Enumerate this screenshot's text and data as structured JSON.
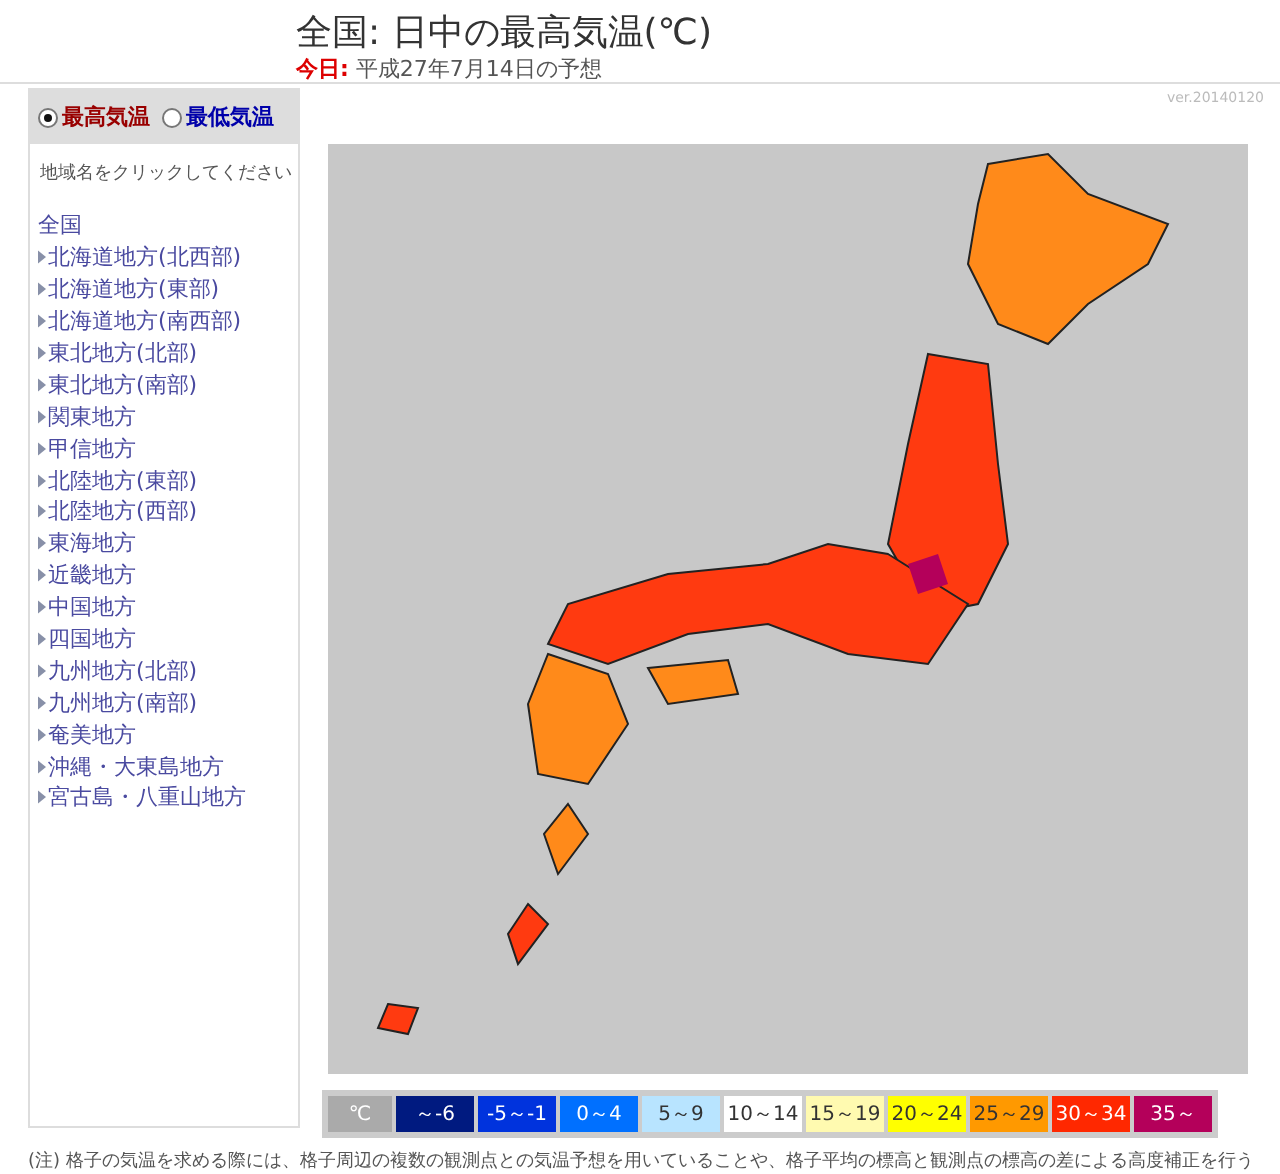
{
  "header": {
    "title": "全国: 日中の最高気温(℃)",
    "date_label": "今日:",
    "date_text": "平成27年7月14日の予想"
  },
  "version": "ver.20140120",
  "sidebar": {
    "radios": [
      {
        "label": "最高気温",
        "selected": true
      },
      {
        "label": "最低気温",
        "selected": false
      }
    ],
    "instruction": "地域名をクリックしてください",
    "items": [
      {
        "label": "全国",
        "kind": "all"
      },
      {
        "label": "北海道地方(北西部)",
        "kind": "region"
      },
      {
        "label": "北海道地方(東部)",
        "kind": "region"
      },
      {
        "label": "北海道地方(南西部)",
        "kind": "region"
      },
      {
        "label": "東北地方(北部)",
        "kind": "region"
      },
      {
        "label": "東北地方(南部)",
        "kind": "region"
      },
      {
        "label": "関東地方",
        "kind": "region"
      },
      {
        "label": "甲信地方",
        "kind": "region"
      },
      {
        "label": "北陸地方(東部)",
        "kind": "region"
      },
      {
        "label": "北陸地方(西部)",
        "kind": "region"
      },
      {
        "label": "東海地方",
        "kind": "region"
      },
      {
        "label": "近畿地方",
        "kind": "region"
      },
      {
        "label": "中国地方",
        "kind": "region"
      },
      {
        "label": "四国地方",
        "kind": "region"
      },
      {
        "label": "九州地方(北部)",
        "kind": "region"
      },
      {
        "label": "九州地方(南部)",
        "kind": "region"
      },
      {
        "label": "奄美地方",
        "kind": "region"
      },
      {
        "label": "沖縄・大東島地方",
        "kind": "region"
      },
      {
        "label": "宮古島・八重山地方",
        "kind": "region"
      }
    ]
  },
  "legend": {
    "unit": "℃",
    "items": [
      {
        "label": "～-6",
        "color": "#001a80"
      },
      {
        "label": "-5～-1",
        "color": "#0033dd"
      },
      {
        "label": "0～4",
        "color": "#0070ff"
      },
      {
        "label": "5～9",
        "color": "#b8e4ff"
      },
      {
        "label": "10～14",
        "color": "#ffffff"
      },
      {
        "label": "15～19",
        "color": "#fffab0"
      },
      {
        "label": "20～24",
        "color": "#ffff00"
      },
      {
        "label": "25～29",
        "color": "#ff9900"
      },
      {
        "label": "30～34",
        "color": "#ff2800"
      },
      {
        "label": "35～",
        "color": "#b4005a"
      }
    ]
  },
  "note": "(注) 格子の気温を求める際には、格子周辺の複数の観測点との気温予想を用いていることや、格子平均の標高と観測点の標高の差による高度補正を行う"
}
